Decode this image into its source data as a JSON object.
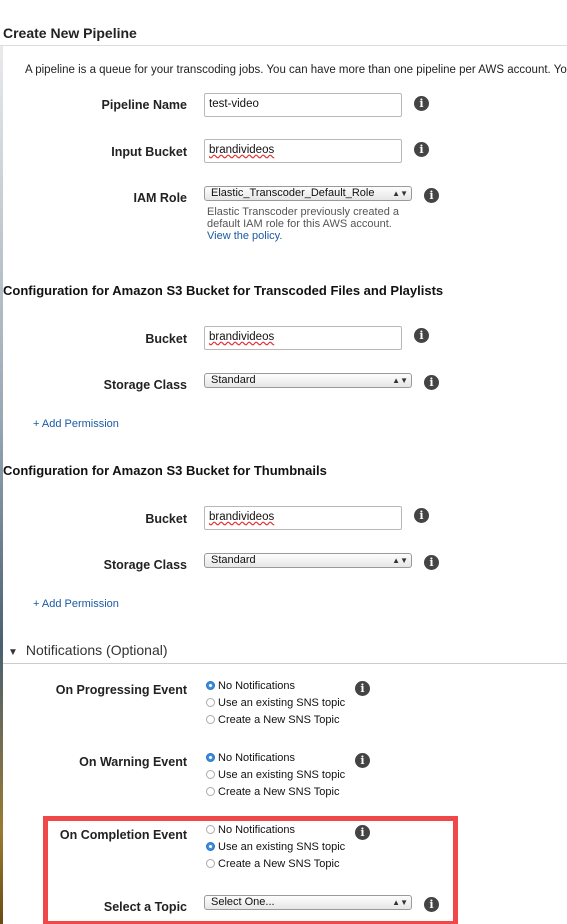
{
  "header": {
    "title": "Create New Pipeline"
  },
  "intro": "A pipeline is a queue for your transcoding jobs. You can have more than one pipeline per AWS account. You ca",
  "pipeline": {
    "name_label": "Pipeline Name",
    "name_value": "test-video",
    "input_label": "Input Bucket",
    "input_value": "brandivideos",
    "iam_label": "IAM Role",
    "iam_value": "Elastic_Transcoder_Default_Role",
    "iam_hint": "Elastic Transcoder previously created a default IAM role for this AWS account.",
    "iam_link": "View the policy."
  },
  "transcoded": {
    "title": "Configuration for Amazon S3 Bucket for Transcoded Files and Playlists",
    "bucket_label": "Bucket",
    "bucket_value": "brandivideos",
    "storage_label": "Storage Class",
    "storage_value": "Standard",
    "add_permission": "+ Add Permission"
  },
  "thumbnails": {
    "title": "Configuration for Amazon S3 Bucket for Thumbnails",
    "bucket_label": "Bucket",
    "bucket_value": "brandivideos",
    "storage_label": "Storage Class",
    "storage_value": "Standard",
    "add_permission": "+ Add Permission"
  },
  "notifications": {
    "title": "Notifications (Optional)",
    "progressing": {
      "label": "On Progressing Event",
      "options": [
        "No Notifications",
        "Use an existing SNS topic",
        "Create a New SNS Topic"
      ],
      "selected": 0
    },
    "warning": {
      "label": "On Warning Event",
      "options": [
        "No Notifications",
        "Use an existing SNS topic",
        "Create a New SNS Topic"
      ],
      "selected": 0
    },
    "completion": {
      "label": "On Completion Event",
      "options": [
        "No Notifications",
        "Use an existing SNS topic",
        "Create a New SNS Topic"
      ],
      "selected": 1
    },
    "topic_label": "Select a Topic",
    "topic_value": "Select One..."
  },
  "icons": {
    "info": "info-icon",
    "select_arrow": "chevron-updown-icon",
    "collapse": "triangle-down-icon"
  },
  "colors": {
    "link": "#1a5aa5",
    "highlight": "#f04848",
    "radio_selected": "#3c8ee0"
  }
}
